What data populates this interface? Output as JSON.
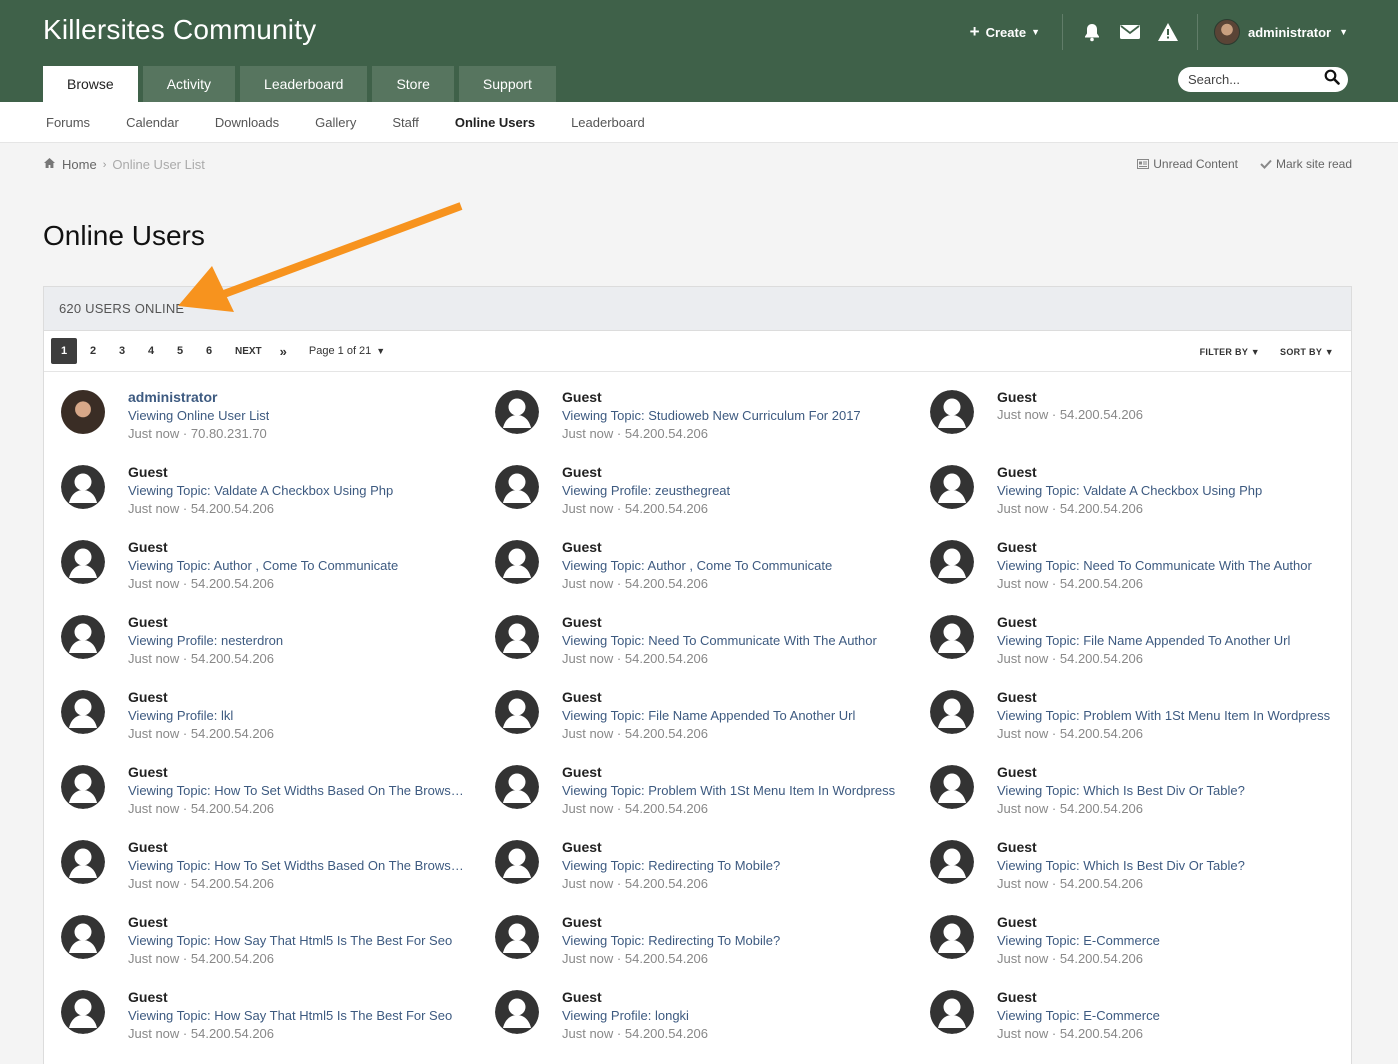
{
  "site": {
    "title": "Killersites Community"
  },
  "userbar": {
    "create_label": "Create",
    "username": "administrator"
  },
  "main_nav": [
    {
      "label": "Browse",
      "active": true
    },
    {
      "label": "Activity",
      "active": false
    },
    {
      "label": "Leaderboard",
      "active": false
    },
    {
      "label": "Store",
      "active": false
    },
    {
      "label": "Support",
      "active": false
    }
  ],
  "search": {
    "placeholder": "Search..."
  },
  "sub_nav": [
    {
      "label": "Forums"
    },
    {
      "label": "Calendar"
    },
    {
      "label": "Downloads"
    },
    {
      "label": "Gallery"
    },
    {
      "label": "Staff"
    },
    {
      "label": "Online Users",
      "active": true
    },
    {
      "label": "Leaderboard"
    }
  ],
  "breadcrumb": {
    "home": "Home",
    "current": "Online User List"
  },
  "breadcrumb_actions": {
    "unread": "Unread Content",
    "mark_read": "Mark site read"
  },
  "page": {
    "title": "Online Users",
    "count_label": "620 USERS ONLINE"
  },
  "pagination": {
    "pages": [
      "1",
      "2",
      "3",
      "4",
      "5",
      "6"
    ],
    "current": "1",
    "next": "NEXT",
    "last": "»",
    "page_of": "Page 1 of 21",
    "filter": "FILTER BY",
    "sort": "SORT BY"
  },
  "colors": {
    "header": "#3f6149",
    "tab": "#57755f",
    "link": "#3d5a80",
    "annotation_arrow": "#f7931e"
  },
  "users": [
    {
      "name": "administrator",
      "location": "Viewing Online User List",
      "time": "Just now",
      "ip": "70.80.231.70",
      "admin": true
    },
    {
      "name": "Guest",
      "location": "Viewing Topic: Studioweb New Curriculum For 2017",
      "time": "Just now",
      "ip": "54.200.54.206"
    },
    {
      "name": "Guest",
      "location": "",
      "time": "Just now",
      "ip": "54.200.54.206"
    },
    {
      "name": "Guest",
      "location": "Viewing Topic: Valdate A Checkbox Using Php",
      "time": "Just now",
      "ip": "54.200.54.206"
    },
    {
      "name": "Guest",
      "location": "Viewing Profile: zeusthegreat",
      "time": "Just now",
      "ip": "54.200.54.206"
    },
    {
      "name": "Guest",
      "location": "Viewing Topic: Valdate A Checkbox Using Php",
      "time": "Just now",
      "ip": "54.200.54.206"
    },
    {
      "name": "Guest",
      "location": "Viewing Topic: Author , Come To Communicate",
      "time": "Just now",
      "ip": "54.200.54.206"
    },
    {
      "name": "Guest",
      "location": "Viewing Topic: Author , Come To Communicate",
      "time": "Just now",
      "ip": "54.200.54.206"
    },
    {
      "name": "Guest",
      "location": "Viewing Topic: Need To Communicate With The Author",
      "time": "Just now",
      "ip": "54.200.54.206"
    },
    {
      "name": "Guest",
      "location": "Viewing Profile: nesterdron",
      "time": "Just now",
      "ip": "54.200.54.206"
    },
    {
      "name": "Guest",
      "location": "Viewing Topic: Need To Communicate With The Author",
      "time": "Just now",
      "ip": "54.200.54.206"
    },
    {
      "name": "Guest",
      "location": "Viewing Topic: File Name Appended To Another Url",
      "time": "Just now",
      "ip": "54.200.54.206"
    },
    {
      "name": "Guest",
      "location": "Viewing Profile: lkl",
      "time": "Just now",
      "ip": "54.200.54.206"
    },
    {
      "name": "Guest",
      "location": "Viewing Topic: File Name Appended To Another Url",
      "time": "Just now",
      "ip": "54.200.54.206"
    },
    {
      "name": "Guest",
      "location": "Viewing Topic: Problem With 1St Menu Item In Wordpress",
      "time": "Just now",
      "ip": "54.200.54.206"
    },
    {
      "name": "Guest",
      "location": "Viewing Topic: How To Set Widths Based On The Browse...",
      "time": "Just now",
      "ip": "54.200.54.206"
    },
    {
      "name": "Guest",
      "location": "Viewing Topic: Problem With 1St Menu Item In Wordpress",
      "time": "Just now",
      "ip": "54.200.54.206"
    },
    {
      "name": "Guest",
      "location": "Viewing Topic: Which Is Best Div Or Table?",
      "time": "Just now",
      "ip": "54.200.54.206"
    },
    {
      "name": "Guest",
      "location": "Viewing Topic: How To Set Widths Based On The Browse...",
      "time": "Just now",
      "ip": "54.200.54.206"
    },
    {
      "name": "Guest",
      "location": "Viewing Topic: Redirecting To Mobile?",
      "time": "Just now",
      "ip": "54.200.54.206"
    },
    {
      "name": "Guest",
      "location": "Viewing Topic: Which Is Best Div Or Table?",
      "time": "Just now",
      "ip": "54.200.54.206"
    },
    {
      "name": "Guest",
      "location": "Viewing Topic: How Say That Html5 Is The Best For Seo",
      "time": "Just now",
      "ip": "54.200.54.206"
    },
    {
      "name": "Guest",
      "location": "Viewing Topic: Redirecting To Mobile?",
      "time": "Just now",
      "ip": "54.200.54.206"
    },
    {
      "name": "Guest",
      "location": "Viewing Topic: E-Commerce",
      "time": "Just now",
      "ip": "54.200.54.206"
    },
    {
      "name": "Guest",
      "location": "Viewing Topic: How Say That Html5 Is The Best For Seo",
      "time": "Just now",
      "ip": "54.200.54.206"
    },
    {
      "name": "Guest",
      "location": "Viewing Profile: longki",
      "time": "Just now",
      "ip": "54.200.54.206"
    },
    {
      "name": "Guest",
      "location": "Viewing Topic: E-Commerce",
      "time": "Just now",
      "ip": "54.200.54.206"
    }
  ]
}
